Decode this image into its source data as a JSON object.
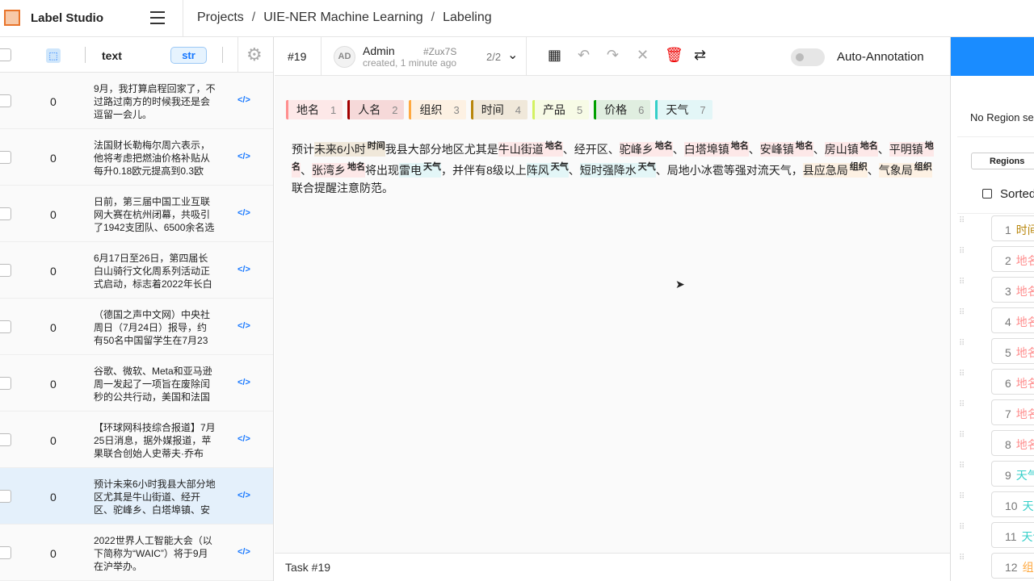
{
  "app": {
    "name": "Label Studio"
  },
  "breadcrumbs": [
    "Projects",
    "UIE-NER Machine Learning",
    "Labeling"
  ],
  "table": {
    "column": "text",
    "type_badge": "str",
    "rows": [
      {
        "value": "0",
        "text": "9月，我打算启程回家了，不过路过南方的时候我还是会逗留一会儿。"
      },
      {
        "value": "0",
        "text": "法国财长勒梅尔周六表示，他将考虑把燃油价格补贴从每升0.18欧元提高到0.3欧"
      },
      {
        "value": "0",
        "text": "日前，第三届中国工业互联网大赛在杭州闭幕，共吸引了1942支团队、6500余名选"
      },
      {
        "value": "0",
        "text": "6月17日至26日，第四届长白山骑行文化周系列活动正式启动，标志着2022年长白"
      },
      {
        "value": "0",
        "text": "（德国之声中文网）中央社周日（7月24日）报导，约有50名中国留学生在7月23"
      },
      {
        "value": "0",
        "text": "谷歌、微软、Meta和亚马逊周一发起了一项旨在废除闰秒的公共行动，美国和法国"
      },
      {
        "value": "0",
        "text": "【环球网科技综合报道】7月25日消息，据外媒报道，苹果联合创始人史蒂夫·乔布"
      },
      {
        "value": "0",
        "text": "预计未来6小时我县大部分地区尤其是牛山街道、经开区、驼峰乡、白塔埠镇、安"
      },
      {
        "value": "0",
        "text": "2022世界人工智能大会（以下简称为“WAIC”）将于9月在沪举办。"
      }
    ]
  },
  "task": {
    "id": "#19",
    "footer": "Task #19"
  },
  "annotation": {
    "avatar": "AD",
    "user": "Admin",
    "hash": "#Zux7S",
    "created": "created, 1 minute ago",
    "count": "2/2"
  },
  "auto_annotation": "Auto-Annotation",
  "labels": [
    {
      "name": "地名",
      "key": "1",
      "color": "#ff8f8f",
      "bg": "#fde8e8"
    },
    {
      "name": "人名",
      "key": "2",
      "color": "#a30000",
      "bg": "#f6d9d9"
    },
    {
      "name": "组织",
      "key": "3",
      "color": "#ffa940",
      "bg": "#fdf1e3"
    },
    {
      "name": "时间",
      "key": "4",
      "color": "#b8860b",
      "bg": "#f0e8da"
    },
    {
      "name": "产品",
      "key": "5",
      "color": "#d3f261",
      "bg": "#f7fbe6"
    },
    {
      "name": "价格",
      "key": "6",
      "color": "#00a000",
      "bg": "#e0eee0"
    },
    {
      "name": "天气",
      "key": "7",
      "color": "#36cfc9",
      "bg": "#e3f6f7"
    }
  ],
  "document": [
    {
      "t": "预计"
    },
    {
      "t": "未来6小时",
      "l": "时间"
    },
    {
      "t": "我县大部分地区尤其是"
    },
    {
      "t": "牛山街道",
      "l": "地名"
    },
    {
      "t": "、经开区、"
    },
    {
      "t": "驼峰乡",
      "l": "地名"
    },
    {
      "t": "、"
    },
    {
      "t": "白塔埠镇",
      "l": "地名"
    },
    {
      "t": "、"
    },
    {
      "t": "安峰镇",
      "l": "地名"
    },
    {
      "t": "、"
    },
    {
      "t": "房山镇",
      "l": "地名"
    },
    {
      "t": "、"
    },
    {
      "t": "平明镇",
      "l": "地名"
    },
    {
      "t": "、"
    },
    {
      "t": "张湾乡",
      "l": "地名"
    },
    {
      "t": "将出现"
    },
    {
      "t": "雷电",
      "l": "天气"
    },
    {
      "t": "，并伴有8级以上"
    },
    {
      "t": "阵风",
      "l": "天气"
    },
    {
      "t": "、"
    },
    {
      "t": "短时强降水",
      "l": "天气"
    },
    {
      "t": "、局地小冰雹等强对流天气，"
    },
    {
      "t": "县应急局",
      "l": "组织"
    },
    {
      "t": "、"
    },
    {
      "t": "气象局",
      "l": "组织"
    },
    {
      "t": "联合提醒注意防范。"
    }
  ],
  "regions": {
    "empty": "No Region se",
    "tab": "Regions",
    "sort": "Sorted",
    "items": [
      {
        "n": "1",
        "l": "时间"
      },
      {
        "n": "2",
        "l": "地名"
      },
      {
        "n": "3",
        "l": "地名"
      },
      {
        "n": "4",
        "l": "地名"
      },
      {
        "n": "5",
        "l": "地名"
      },
      {
        "n": "6",
        "l": "地名"
      },
      {
        "n": "7",
        "l": "地名"
      },
      {
        "n": "8",
        "l": "地名"
      },
      {
        "n": "9",
        "l": "天气"
      },
      {
        "n": "10",
        "l": "天气"
      },
      {
        "n": "11",
        "l": "天气"
      },
      {
        "n": "12",
        "l": "组织"
      }
    ]
  }
}
